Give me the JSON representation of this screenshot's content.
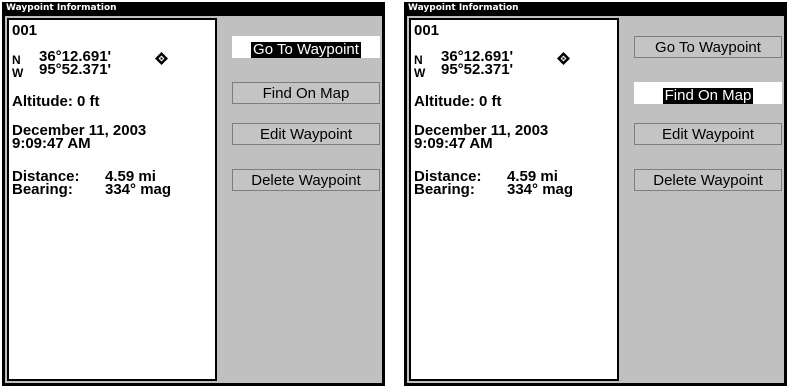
{
  "screens": [
    {
      "title": "Waypoint Information",
      "waypoint_name": "001",
      "lat_hemisphere": "N",
      "lat_value": "36°12.691'",
      "lon_hemisphere": "W",
      "lon_value": "95°52.371'",
      "altitude": "Altitude: 0 ft",
      "date": "December 11, 2003",
      "time": "9:09:47 AM",
      "distance_label": "Distance:",
      "distance_value": "4.59 mi",
      "bearing_label": "Bearing:",
      "bearing_value": "334° mag",
      "buttons": [
        "Go To Waypoint",
        "Find On Map",
        "Edit Waypoint",
        "Delete Waypoint"
      ],
      "selected_button": "Go To Waypoint"
    },
    {
      "title": "Waypoint Information",
      "waypoint_name": "001",
      "lat_hemisphere": "N",
      "lat_value": "36°12.691'",
      "lon_hemisphere": "W",
      "lon_value": "95°52.371'",
      "altitude": "Altitude: 0 ft",
      "date": "December 11, 2003",
      "time": "9:09:47 AM",
      "distance_label": "Distance:",
      "distance_value": "4.59 mi",
      "bearing_label": "Bearing:",
      "bearing_value": "334° mag",
      "buttons": [
        "Go To Waypoint",
        "Find On Map",
        "Edit Waypoint",
        "Delete Waypoint"
      ],
      "selected_button": "Find On Map"
    }
  ],
  "icons": {
    "waypoint_marker": "waypoint-diamond-icon"
  },
  "colors": {
    "frame": "#000000",
    "panel": "#c0c0c0",
    "highlight": "#000000"
  }
}
